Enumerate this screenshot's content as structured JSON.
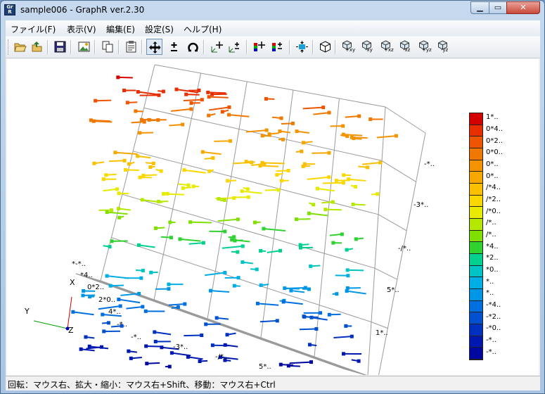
{
  "window": {
    "title": "sample006 - GraphR ver.2.30",
    "icon_text": "GraphR"
  },
  "menu": [
    {
      "label": "ファイル(F)"
    },
    {
      "label": "表示(V)"
    },
    {
      "label": "編集(E)"
    },
    {
      "label": "設定(S)"
    },
    {
      "label": "ヘルプ(H)"
    }
  ],
  "toolbar": {
    "buttons": [
      {
        "icon": "open-folder-icon"
      },
      {
        "icon": "open-data-icon"
      },
      {
        "icon": "save-icon"
      },
      {
        "icon": "export-image-icon"
      },
      {
        "icon": "copy-icon"
      },
      {
        "icon": "clipboard-icon"
      },
      {
        "icon": "move-icon",
        "pressed": true
      },
      {
        "icon": "plus-minus-icon"
      },
      {
        "icon": "rotate-icon"
      },
      {
        "icon": "axis-move-icon"
      },
      {
        "icon": "axis-scale-icon"
      },
      {
        "icon": "colorbar-move-icon"
      },
      {
        "icon": "colorbar-scale-icon"
      },
      {
        "icon": "fit-view-icon"
      },
      {
        "icon": "cube-icon"
      },
      {
        "icon": "view-plus-xy-icon",
        "sub": "+xy"
      },
      {
        "icon": "view-minus-xy-icon",
        "sub": "-xy"
      },
      {
        "icon": "view-plus-xz-icon",
        "sub": "+xz"
      },
      {
        "icon": "view-minus-xz-icon",
        "sub": "-xz"
      },
      {
        "icon": "view-plus-yz-icon",
        "sub": "+yz"
      },
      {
        "icon": "view-minus-yz-icon",
        "sub": "-yz"
      }
    ]
  },
  "colorbar": {
    "labels": [
      "1*..",
      "0*4..",
      "0*2..",
      "0*0..",
      "0*..",
      "0*..",
      "/*4..",
      "/*2..",
      "/*0..",
      "/*..",
      "/*..",
      "*4..",
      "*2..",
      "*0..",
      "*..",
      "*..",
      "-*4..",
      "-*2..",
      "-*0..",
      "-*..",
      "-*.."
    ],
    "colors": [
      "#d40000",
      "#e82d00",
      "#ef5500",
      "#f07800",
      "#f39300",
      "#f7a800",
      "#fac000",
      "#fbd700",
      "#e8ea00",
      "#b5e800",
      "#7fe000",
      "#2fd22f",
      "#00d090",
      "#00c4c4",
      "#00aee6",
      "#0096e6",
      "#0070e0",
      "#0050d0",
      "#0030c0",
      "#0018b0",
      "#0008a0"
    ]
  },
  "axes": {
    "z_side": [
      "-*..",
      "-3*..",
      "-/*..",
      "5*..",
      "1*.."
    ],
    "x_side": [
      "*-*..",
      "*4..",
      "0*2..",
      "2*0..",
      "4*.."
    ],
    "y_side": [
      "-*..",
      "-*..",
      "-3*..",
      "-/*..",
      "5*.."
    ],
    "triad": {
      "x": "X",
      "y": "Y",
      "z": "Z"
    }
  },
  "status": "回転：マウス右、拡大・縮小：マウス右+Shift、移動：マウス右+Ctrl"
}
